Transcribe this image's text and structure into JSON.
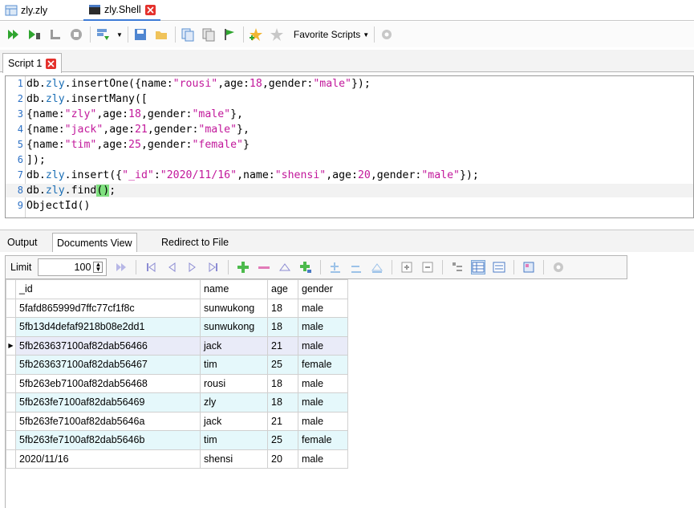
{
  "tabs": [
    {
      "label": "zly.zly",
      "active": false
    },
    {
      "label": "zly.Shell",
      "active": true
    }
  ],
  "toolbar": {
    "favorite_label": "Favorite Scripts"
  },
  "script_tab": {
    "label": "Script 1"
  },
  "editor": {
    "lines": [
      {
        "num": "1",
        "tokens": [
          [
            "db.",
            "obj"
          ],
          [
            "zly",
            "coll"
          ],
          [
            ".insertOne({name:",
            "obj"
          ],
          [
            "\"rousi\"",
            "str"
          ],
          [
            ",age:",
            "obj"
          ],
          [
            "18",
            "num"
          ],
          [
            ",gender:",
            "obj"
          ],
          [
            "\"male\"",
            "str"
          ],
          [
            "});",
            "obj"
          ]
        ]
      },
      {
        "num": "2",
        "tokens": [
          [
            "db.",
            "obj"
          ],
          [
            "zly",
            "coll"
          ],
          [
            ".insertMany([",
            "obj"
          ]
        ]
      },
      {
        "num": "3",
        "tokens": [
          [
            "{name:",
            "obj"
          ],
          [
            "\"zly\"",
            "str"
          ],
          [
            ",age:",
            "obj"
          ],
          [
            "18",
            "num"
          ],
          [
            ",gender:",
            "obj"
          ],
          [
            "\"male\"",
            "str"
          ],
          [
            "},",
            "obj"
          ]
        ]
      },
      {
        "num": "4",
        "tokens": [
          [
            "{name:",
            "obj"
          ],
          [
            "\"jack\"",
            "str"
          ],
          [
            ",age:",
            "obj"
          ],
          [
            "21",
            "num"
          ],
          [
            ",gender:",
            "obj"
          ],
          [
            "\"male\"",
            "str"
          ],
          [
            "},",
            "obj"
          ]
        ]
      },
      {
        "num": "5",
        "tokens": [
          [
            "{name:",
            "obj"
          ],
          [
            "\"tim\"",
            "str"
          ],
          [
            ",age:",
            "obj"
          ],
          [
            "25",
            "num"
          ],
          [
            ",gender:",
            "obj"
          ],
          [
            "\"female\"",
            "str"
          ],
          [
            "}",
            "obj"
          ]
        ]
      },
      {
        "num": "6",
        "tokens": [
          [
            "]);",
            "obj"
          ]
        ]
      },
      {
        "num": "7",
        "tokens": [
          [
            "db.",
            "obj"
          ],
          [
            "zly",
            "coll"
          ],
          [
            ".insert({",
            "obj"
          ],
          [
            "\"_id\"",
            "str"
          ],
          [
            ":",
            "obj"
          ],
          [
            "\"2020/11/16\"",
            "str"
          ],
          [
            ",name:",
            "obj"
          ],
          [
            "\"shensi\"",
            "str"
          ],
          [
            ",age:",
            "obj"
          ],
          [
            "20",
            "num"
          ],
          [
            ",gender:",
            "obj"
          ],
          [
            "\"male\"",
            "str"
          ],
          [
            "});",
            "obj"
          ]
        ]
      },
      {
        "num": "8",
        "tokens": [
          [
            "db.",
            "obj"
          ],
          [
            "zly",
            "coll"
          ],
          [
            ".find",
            "obj"
          ],
          [
            "()",
            "hl"
          ],
          [
            ";",
            "obj"
          ]
        ]
      },
      {
        "num": "9",
        "tokens": [
          [
            "ObjectId()",
            "obj"
          ]
        ]
      }
    ]
  },
  "bottom_tabs": [
    {
      "label": "Output",
      "active": false
    },
    {
      "label": "Documents View",
      "active": true
    },
    {
      "label": "Redirect to File",
      "active": false
    }
  ],
  "grid_toolbar": {
    "limit_label": "Limit",
    "limit_value": "100"
  },
  "table": {
    "columns": [
      "_id",
      "name",
      "age",
      "gender"
    ],
    "rows": [
      [
        "5fafd865999d7ffc77cf1f8c",
        "sunwukong",
        "18",
        "male"
      ],
      [
        "5fb13d4defaf9218b08e2dd1",
        "sunwukong",
        "18",
        "male"
      ],
      [
        "5fb263637100af82dab56466",
        "jack",
        "21",
        "male"
      ],
      [
        "5fb263637100af82dab56467",
        "tim",
        "25",
        "female"
      ],
      [
        "5fb263eb7100af82dab56468",
        "rousi",
        "18",
        "male"
      ],
      [
        "5fb263fe7100af82dab56469",
        "zly",
        "18",
        "male"
      ],
      [
        "5fb263fe7100af82dab5646a",
        "jack",
        "21",
        "male"
      ],
      [
        "5fb263fe7100af82dab5646b",
        "tim",
        "25",
        "female"
      ],
      [
        "2020/11/16",
        "shensi",
        "20",
        "male"
      ]
    ],
    "selected_row": 2
  }
}
